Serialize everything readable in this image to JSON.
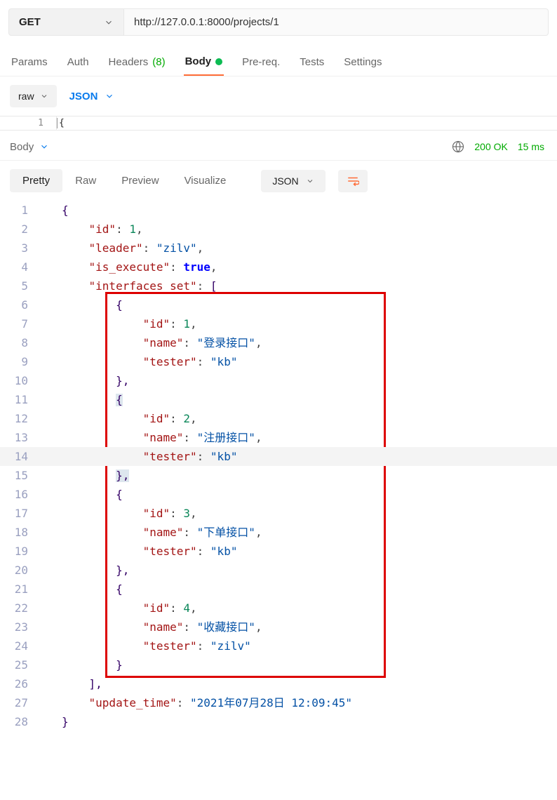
{
  "request": {
    "method": "GET",
    "url": "http://127.0.0.1:8000/projects/1"
  },
  "tabs": {
    "params": "Params",
    "auth": "Auth",
    "headers": "Headers",
    "headers_count": "(8)",
    "body": "Body",
    "prereq": "Pre-req.",
    "tests": "Tests",
    "settings": "Settings"
  },
  "bodytype": {
    "raw": "raw",
    "json": "JSON"
  },
  "mini_editor": {
    "line": "1",
    "cursor": "{"
  },
  "response": {
    "label": "Body",
    "status": "200 OK",
    "time": "15 ms"
  },
  "viewtabs": {
    "pretty": "Pretty",
    "raw": "Raw",
    "preview": "Preview",
    "visualize": "Visualize",
    "json": "JSON"
  },
  "code": {
    "l1": "{",
    "l2": {
      "k": "\"id\"",
      "v": "1"
    },
    "l3": {
      "k": "\"leader\"",
      "v": "\"zilv\""
    },
    "l4": {
      "k": "\"is_execute\"",
      "v": "true"
    },
    "l5": {
      "k": "\"interfaces_set\"",
      "v": "["
    },
    "l6": "{",
    "l7": {
      "k": "\"id\"",
      "v": "1"
    },
    "l8": {
      "k": "\"name\"",
      "v": "\"登录接口\""
    },
    "l9": {
      "k": "\"tester\"",
      "v": "\"kb\""
    },
    "l10": "},",
    "l11": "{",
    "l12": {
      "k": "\"id\"",
      "v": "2"
    },
    "l13": {
      "k": "\"name\"",
      "v": "\"注册接口\""
    },
    "l14": {
      "k": "\"tester\"",
      "v": "\"kb\""
    },
    "l15": "},",
    "l16": "{",
    "l17": {
      "k": "\"id\"",
      "v": "3"
    },
    "l18": {
      "k": "\"name\"",
      "v": "\"下单接口\""
    },
    "l19": {
      "k": "\"tester\"",
      "v": "\"kb\""
    },
    "l20": "},",
    "l21": "{",
    "l22": {
      "k": "\"id\"",
      "v": "4"
    },
    "l23": {
      "k": "\"name\"",
      "v": "\"收藏接口\""
    },
    "l24": {
      "k": "\"tester\"",
      "v": "\"zilv\""
    },
    "l25": "}",
    "l26": "],",
    "l27": {
      "k": "\"update_time\"",
      "v": "\"2021年07月28日 12:09:45\""
    },
    "l28": "}"
  }
}
